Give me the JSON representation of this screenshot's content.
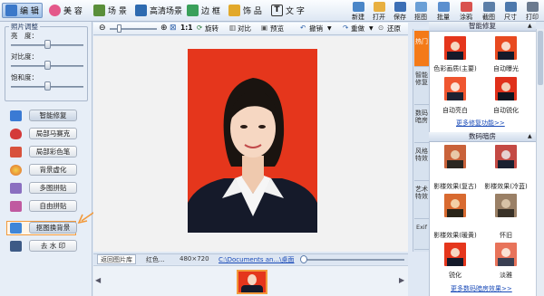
{
  "toolbar": {
    "tabs": [
      {
        "label": "编 辑",
        "icon": "edit-icon",
        "color": "#3b78c9"
      },
      {
        "label": "美 容",
        "icon": "face-icon",
        "color": "#e4588a"
      },
      {
        "label": "场 景",
        "icon": "scene-icon",
        "color": "#5a8f3a"
      },
      {
        "label": "高清场景",
        "icon": "hd-scene-icon",
        "color": "#2d6ab0"
      },
      {
        "label": "边 框",
        "icon": "frame-icon",
        "color": "#3aa05a"
      },
      {
        "label": "饰 品",
        "icon": "decoration-icon",
        "color": "#e2a92b"
      },
      {
        "label": "文 字",
        "icon": "text-icon",
        "color": "#333333"
      }
    ],
    "actions": [
      {
        "label": "新建",
        "icon": "new-icon",
        "color": "#4a86c8"
      },
      {
        "label": "打开",
        "icon": "open-icon",
        "color": "#e8b040"
      },
      {
        "label": "保存",
        "icon": "save-icon",
        "color": "#3c6fb5"
      },
      {
        "label": "抠图",
        "icon": "cutout-icon",
        "color": "#6a9fd6"
      },
      {
        "label": "批量",
        "icon": "batch-icon",
        "color": "#5b8fcf"
      },
      {
        "label": "涂鸦",
        "icon": "doodle-icon",
        "color": "#d9534f"
      },
      {
        "label": "截图",
        "icon": "screenshot-icon",
        "color": "#5c7fa8"
      },
      {
        "label": "尺寸",
        "icon": "size-icon",
        "color": "#4d79ad"
      },
      {
        "label": "打印",
        "icon": "print-icon",
        "color": "#6b7b8f"
      }
    ]
  },
  "adjust": {
    "legend": "照片调整",
    "brightness": {
      "label": "亮　度：",
      "value": 0.5
    },
    "contrast": {
      "label": "对比度：",
      "value": 0.5
    },
    "saturation": {
      "label": "饱和度：",
      "value": 0.5
    }
  },
  "tools": [
    {
      "label": "智能修复",
      "icon": "smart-fix-icon",
      "color": "#3a7ad4"
    },
    {
      "label": "局部马赛克",
      "icon": "mosaic-icon",
      "color": "#d43a3a"
    },
    {
      "label": "局部彩色笔",
      "icon": "color-pen-icon",
      "color": "#d8523c"
    },
    {
      "label": "背景虚化",
      "icon": "blur-icon",
      "color": "#e0a030"
    },
    {
      "label": "多图拼贴",
      "icon": "collage-icon",
      "color": "#8a6fc0"
    },
    {
      "label": "自由拼贴",
      "icon": "free-collage-icon",
      "color": "#c05aa0"
    },
    {
      "label": "抠图换背景",
      "icon": "cutout-bg-icon",
      "color": "#3f86d8"
    },
    {
      "label": "去 水 印",
      "icon": "watermark-icon",
      "color": "#3d5a86"
    }
  ],
  "canvas_toolbar": {
    "zoom_fit": "1:1",
    "rotate": "旋转",
    "compare": "对比",
    "preview": "预览",
    "undo": "撤销",
    "redo": "重做",
    "restore": "还原"
  },
  "status": {
    "back_button": "返回图片库",
    "color_name": "红色...",
    "dimensions": "480×720",
    "path": "C:\\Documents an...\\桌面"
  },
  "right_panel": {
    "tabs": [
      "热门",
      "智能修复",
      "数码暗房",
      "风格特效",
      "艺术特效",
      "Exif"
    ],
    "section1": {
      "title": "智能修复",
      "items": [
        "色彩画质(主要)",
        "自动曝光",
        "自动亮白",
        "自动锐化"
      ],
      "more": "更多修复功能>>"
    },
    "section2": {
      "title": "数码暗房",
      "items": [
        "影楼效果(复古)",
        "影楼效果(冷蓝)",
        "影楼效果(暖黄)",
        "怀旧",
        "锐化",
        "淡雅"
      ],
      "more": "更多数码暗房效果>>"
    }
  },
  "colors": {
    "accent": "#f29a3c",
    "photo_bg": "#e5361c",
    "link": "#1a4bb8"
  }
}
